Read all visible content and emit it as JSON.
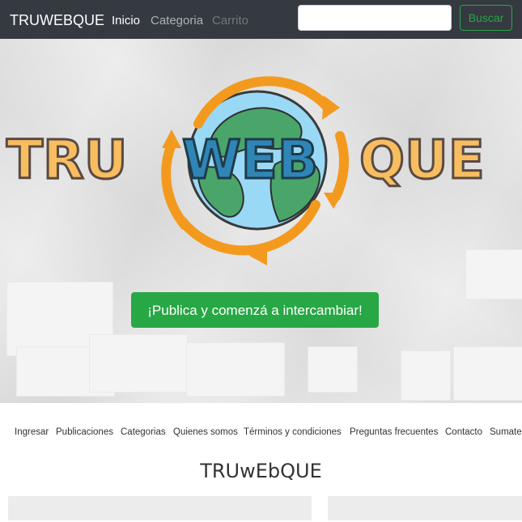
{
  "navbar": {
    "brand": "TRUWEBQUE",
    "links": [
      "Inicio",
      "Categoria",
      "Carrito"
    ],
    "search_placeholder": "",
    "search_button": "Buscar"
  },
  "hero": {
    "logo_text": {
      "left": "TRU",
      "middle": "WEB",
      "right": "QUE"
    },
    "cta_label": "¡Publica y comenzá a intercambiar!"
  },
  "footer_links": [
    "Ingresar",
    "Publicaciones",
    "Categorias",
    "Quienes somos",
    "Términos y condiciones",
    "Preguntas frecuentes",
    "Contacto",
    "Sumate"
  ],
  "footer": {
    "title": "TRUwEbQUE"
  },
  "colors": {
    "navbar_bg": "#343a40",
    "accent_green": "#28a745",
    "logo_orange": "#f7bd5f",
    "logo_outline": "#5a4a44",
    "logo_blue": "#2f86b6",
    "globe_water": "#9ad9f5",
    "globe_land": "#4aa56b",
    "arrow_orange": "#f39a1e"
  }
}
